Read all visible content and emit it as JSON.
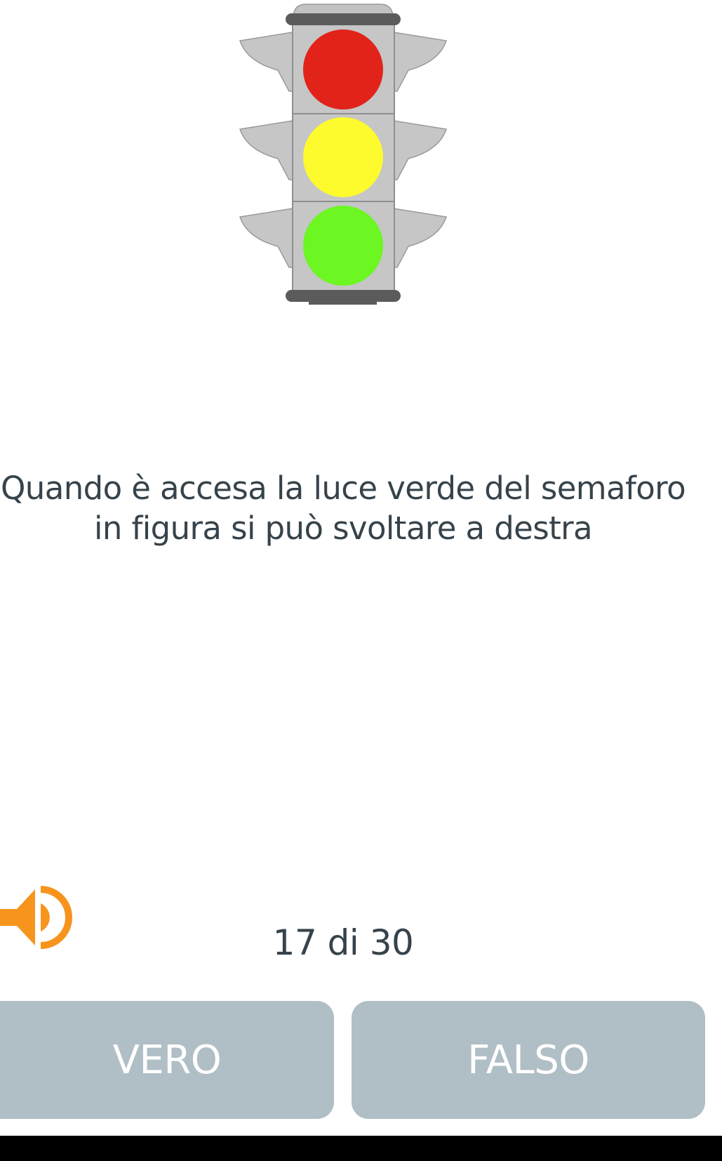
{
  "question": {
    "lines": [
      "Quando è accesa la luce verde del semaforo",
      "in figura si può svoltare a destra"
    ]
  },
  "progress": {
    "label": "17 di 30",
    "current": 17,
    "total": 30
  },
  "answers": {
    "true_label": "VERO",
    "false_label": "FALSO"
  },
  "icons": {
    "audio": "speaker-icon",
    "figure": "traffic-light"
  },
  "colors": {
    "text": "#37434b",
    "button_bg": "#b0bec5",
    "button_text": "#ffffff",
    "audio_icon": "#f7941d",
    "light_red": "#e2231a",
    "light_yellow": "#fdfa2e",
    "light_green": "#6cf622",
    "housing": "#c6c6c6"
  }
}
